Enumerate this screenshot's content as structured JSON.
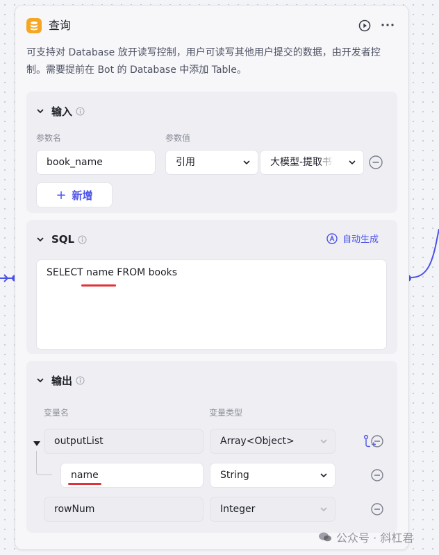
{
  "node": {
    "title": "查询",
    "description": "可支持对 Database 放开读写控制，用户可读写其他用户提交的数据，由开发者控制。需要提前在 Bot 的 Database 中添加 Table。",
    "header_icon": "database-icon",
    "accent_color": "#4d53e8",
    "icon_color": "#f5a623"
  },
  "input": {
    "title": "输入",
    "param_name_label": "参数名",
    "param_value_label": "参数值",
    "params": [
      {
        "name": "book_name",
        "value_type": "引用",
        "value": "大模型-提取书"
      }
    ],
    "add_label": "新增"
  },
  "sql": {
    "title": "SQL",
    "auto_generate_label": "自动生成",
    "query": "SELECT name FROM books"
  },
  "output": {
    "title": "输出",
    "var_name_label": "变量名",
    "var_type_label": "变量类型",
    "vars": [
      {
        "name": "outputList",
        "type": "Array<Object>"
      },
      {
        "name": "name",
        "type": "String"
      },
      {
        "name": "rowNum",
        "type": "Integer"
      }
    ]
  },
  "watermark": "公众号 · 斜杠君"
}
